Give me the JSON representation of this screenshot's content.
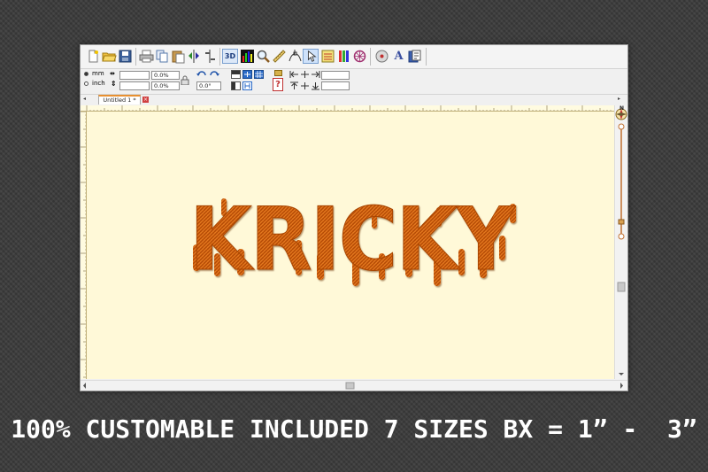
{
  "toolbar2": {
    "unit_mm": "mm",
    "unit_inch": "inch",
    "width_percent": "0.0%",
    "height_percent": "0.0%",
    "rotation": "0.0°"
  },
  "tab": {
    "label": "Untitled 1 *"
  },
  "compass": {
    "north": "N"
  },
  "design": {
    "text": "KRICKY",
    "thread_color": "#d4620e"
  },
  "caption": "100% CUSTOMABLE INCLUDED 7 SIZES BX = 1” -  3”",
  "icons": [
    "new-file-icon",
    "open-folder-icon",
    "save-icon",
    "print-icon",
    "copy-icon",
    "paste-icon",
    "mirror-horizontal-icon",
    "mirror-vertical-icon",
    "3d-view-icon",
    "color-palette-icon",
    "zoom-icon",
    "measure-icon",
    "node-edit-icon",
    "select-icon",
    "stitch-order-icon",
    "color-change-icon",
    "wreath-icon",
    "disk-icon",
    "text-tool-icon",
    "trace-icon"
  ]
}
